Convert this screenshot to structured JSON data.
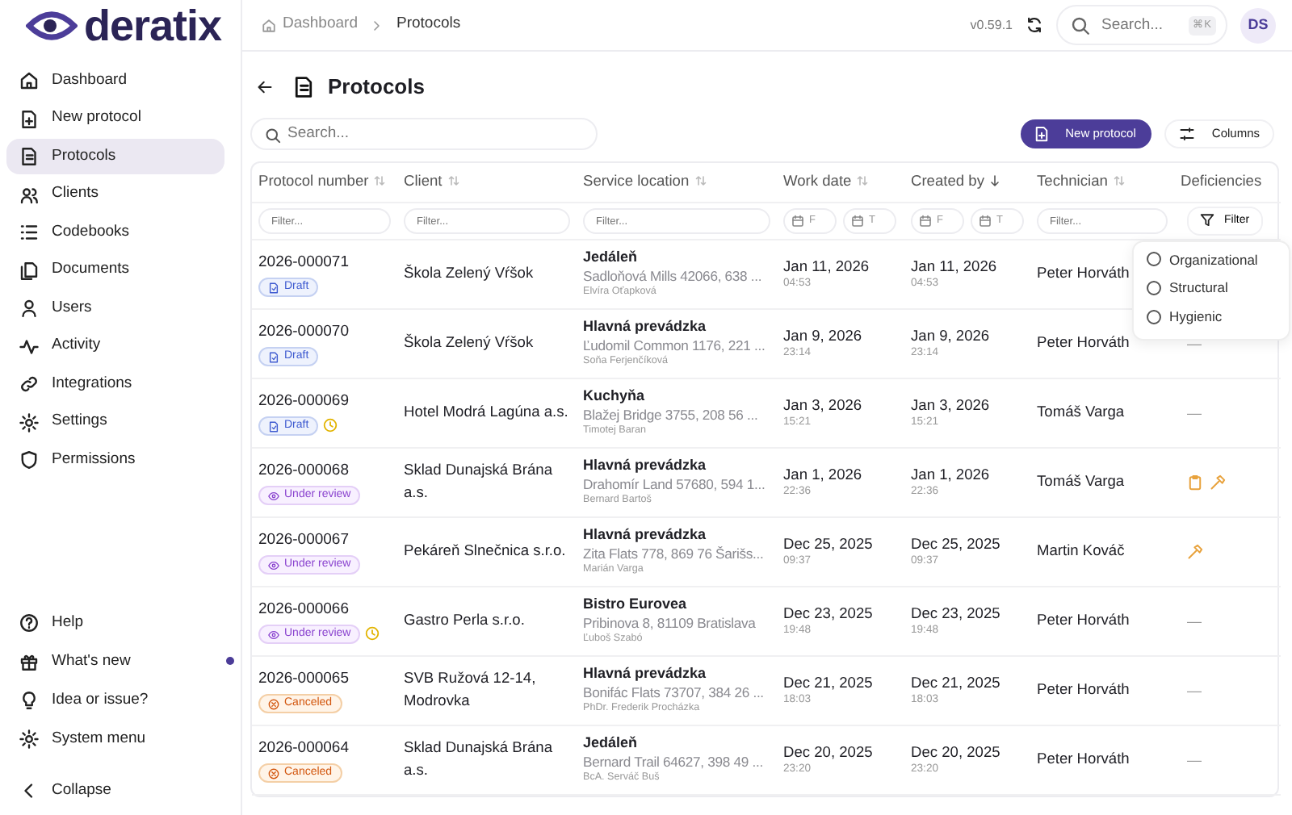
{
  "logo": {
    "text": "deratix"
  },
  "sidebar": {
    "items": [
      {
        "label": "Dashboard",
        "selected": false
      },
      {
        "label": "New protocol",
        "selected": false
      },
      {
        "label": "Protocols",
        "selected": true
      },
      {
        "label": "Clients",
        "selected": false
      },
      {
        "label": "Codebooks",
        "selected": false
      },
      {
        "label": "Documents",
        "selected": false
      },
      {
        "label": "Users",
        "selected": false
      },
      {
        "label": "Activity",
        "selected": false
      },
      {
        "label": "Integrations",
        "selected": false
      },
      {
        "label": "Settings",
        "selected": false
      },
      {
        "label": "Permissions",
        "selected": false
      }
    ],
    "bottom_items": [
      {
        "label": "Help",
        "unread": false
      },
      {
        "label": "What's new",
        "unread": true
      },
      {
        "label": "Idea or issue?",
        "unread": false
      },
      {
        "label": "System menu",
        "unread": false
      },
      {
        "label": "Collapse",
        "unread": false
      }
    ]
  },
  "breadcrumb": [
    "Dashboard",
    "Protocols"
  ],
  "topbar": {
    "version": "v0.59.1",
    "search": {
      "placeholder": "Search...",
      "shortcut": "⌘K"
    },
    "avatar": "DS"
  },
  "page": {
    "title": "Protocols",
    "search": {
      "placeholder": "Search..."
    },
    "buttons": [
      {
        "label": "New protocol",
        "kind": "primary"
      },
      {
        "label": "Columns",
        "kind": "secondary"
      }
    ]
  },
  "table": {
    "columns": [
      {
        "label": "Protocol number",
        "sorted": false,
        "filter": {
          "kind": "text",
          "placeholder": "Filter..."
        }
      },
      {
        "label": "Client",
        "sorted": false,
        "filter": {
          "kind": "text",
          "placeholder": "Filter..."
        }
      },
      {
        "label": "Service location",
        "sorted": false,
        "filter": {
          "kind": "text",
          "placeholder": "Filter..."
        }
      },
      {
        "label": "Work date",
        "sorted": false,
        "filter": {
          "kind": "date",
          "from": "F",
          "to": "T"
        }
      },
      {
        "label": "Created by",
        "sorted": true,
        "filter": {
          "kind": "date",
          "from": "F",
          "to": "T"
        }
      },
      {
        "label": "Technician",
        "sorted": false,
        "filter": {
          "kind": "text",
          "placeholder": "Filter..."
        }
      },
      {
        "label": "Deficiencies",
        "filter": {
          "kind": "button",
          "label": "Filter"
        }
      }
    ],
    "rows": [
      {
        "number": "2026-000071",
        "status": {
          "kind": "draft",
          "label": "Draft"
        },
        "pending": false,
        "client": "Škola Zelený Vŕšok",
        "location": "Jedáleň",
        "address": "Sadloňová Mills 42066, 638 ...",
        "contact": "Elvíra Oťapková",
        "work_date": "Jan 11, 2026",
        "work_time": "04:53",
        "created_date": "Jan 11, 2026",
        "created_time": "04:53",
        "technician": "Peter Horváth",
        "deficiencies": {
          "kind": "hidden"
        }
      },
      {
        "number": "2026-000070",
        "status": {
          "kind": "draft",
          "label": "Draft"
        },
        "pending": false,
        "client": "Škola Zelený Vŕšok",
        "location": "Hlavná prevádzka",
        "address": "Ľudomil Common 1176, 221 ...",
        "contact": "Soňa Ferjenčíková",
        "work_date": "Jan 9, 2026",
        "work_time": "23:14",
        "created_date": "Jan 9, 2026",
        "created_time": "23:14",
        "technician": "Peter Horváth",
        "deficiencies": {
          "kind": "none",
          "text": "—"
        }
      },
      {
        "number": "2026-000069",
        "status": {
          "kind": "draft",
          "label": "Draft"
        },
        "pending": true,
        "client": "Hotel Modrá Lagúna a.s.",
        "location": "Kuchyňa",
        "address": "Blažej Bridge 3755, 208 56 ...",
        "contact": "Timotej Baran",
        "work_date": "Jan 3, 2026",
        "work_time": "15:21",
        "created_date": "Jan 3, 2026",
        "created_time": "15:21",
        "technician": "Tomáš Varga",
        "deficiencies": {
          "kind": "none",
          "text": "—"
        }
      },
      {
        "number": "2026-000068",
        "status": {
          "kind": "review",
          "label": "Under review"
        },
        "pending": false,
        "client": "Sklad Dunajská Brána a.s.",
        "location": "Hlavná prevádzka",
        "address": "Drahomír Land 57680, 594 1...",
        "contact": "Bernard Bartoš",
        "work_date": "Jan 1, 2026",
        "work_time": "22:36",
        "created_date": "Jan 1, 2026",
        "created_time": "22:36",
        "technician": "Tomáš Varga",
        "deficiencies": {
          "kind": "icons",
          "organizational": true,
          "structural": true
        }
      },
      {
        "number": "2026-000067",
        "status": {
          "kind": "review",
          "label": "Under review"
        },
        "pending": false,
        "client": "Pekáreň Slnečnica s.r.o.",
        "location": "Hlavná prevádzka",
        "address": "Zita Flats 778, 869 76 Šarišs...",
        "contact": "Marián Varga",
        "work_date": "Dec 25, 2025",
        "work_time": "09:37",
        "created_date": "Dec 25, 2025",
        "created_time": "09:37",
        "technician": "Martin Kováč",
        "deficiencies": {
          "kind": "icons",
          "organizational": false,
          "structural": true
        }
      },
      {
        "number": "2026-000066",
        "status": {
          "kind": "review",
          "label": "Under review"
        },
        "pending": true,
        "client": "Gastro Perla s.r.o.",
        "location": "Bistro Eurovea",
        "address": "Pribinova 8, 81109 Bratislava",
        "contact": "Ľuboš Szabó",
        "work_date": "Dec 23, 2025",
        "work_time": "19:48",
        "created_date": "Dec 23, 2025",
        "created_time": "19:48",
        "technician": "Peter Horváth",
        "deficiencies": {
          "kind": "none",
          "text": "—"
        }
      },
      {
        "number": "2026-000065",
        "status": {
          "kind": "canceled",
          "label": "Canceled"
        },
        "pending": false,
        "client": "SVB Ružová 12-14, Modrovka",
        "location": "Hlavná prevádzka",
        "address": "Bonifác Flats 73707, 384 26 ...",
        "contact": "PhDr. Frederik Procházka",
        "work_date": "Dec 21, 2025",
        "work_time": "18:03",
        "created_date": "Dec 21, 2025",
        "created_time": "18:03",
        "technician": "Peter Horváth",
        "deficiencies": {
          "kind": "none",
          "text": "—"
        }
      },
      {
        "number": "2026-000064",
        "status": {
          "kind": "canceled",
          "label": "Canceled"
        },
        "pending": false,
        "client": "Sklad Dunajská Brána a.s.",
        "location": "Jedáleň",
        "address": "Bernard Trail 64627, 398 49 ...",
        "contact": "BcA. Serváč Buš",
        "work_date": "Dec 20, 2025",
        "work_time": "23:20",
        "created_date": "Dec 20, 2025",
        "created_time": "23:20",
        "technician": "Peter Horváth",
        "deficiencies": {
          "kind": "none",
          "text": "—"
        }
      }
    ]
  },
  "deficiency_filter": {
    "options": [
      {
        "label": "Organizational",
        "checked": false
      },
      {
        "label": "Structural",
        "checked": false
      },
      {
        "label": "Hygienic",
        "checked": false
      }
    ]
  }
}
